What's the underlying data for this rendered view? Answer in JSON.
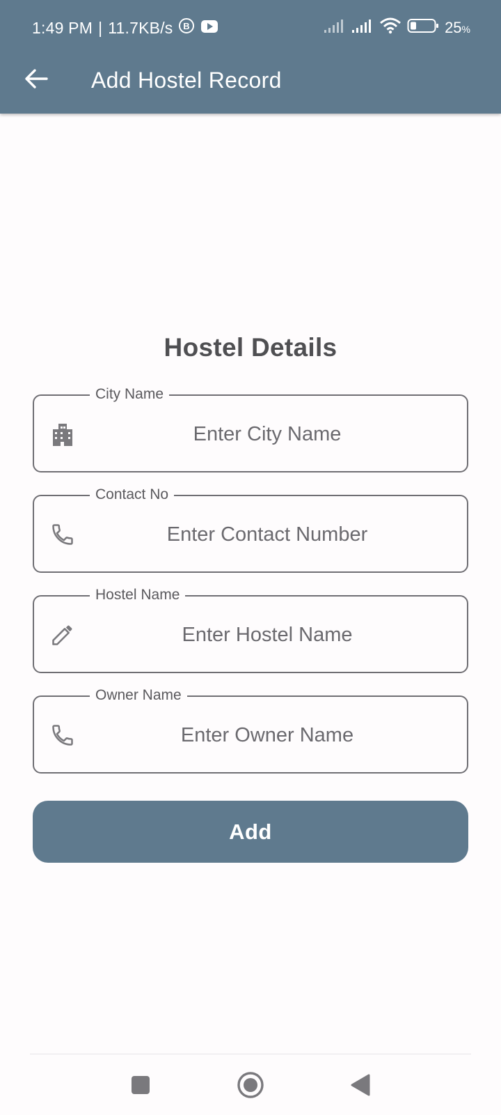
{
  "status_bar": {
    "time": "1:49 PM",
    "separator": "|",
    "speed": "11.7KB/s",
    "battery_percent": "25",
    "battery_unit": "%",
    "icons": [
      "b-circle-icon",
      "youtube-icon",
      "signal-weak-icon",
      "signal-icon",
      "wifi-icon",
      "battery-icon"
    ]
  },
  "app_bar": {
    "title": "Add Hostel Record",
    "back_icon": "arrow-left-icon"
  },
  "form": {
    "title": "Hostel Details",
    "fields": [
      {
        "label": "City Name",
        "placeholder": "Enter City Name",
        "value": "",
        "icon": "building-icon"
      },
      {
        "label": "Contact No",
        "placeholder": "Enter Contact Number",
        "value": "",
        "icon": "phone-icon"
      },
      {
        "label": "Hostel Name",
        "placeholder": "Enter Hostel Name",
        "value": "",
        "icon": "pencil-icon"
      },
      {
        "label": "Owner Name",
        "placeholder": "Enter Owner Name",
        "value": "",
        "icon": "phone-icon"
      }
    ],
    "submit_label": "Add"
  },
  "nav_bar": {
    "buttons": [
      "recents-square-icon",
      "home-circle-icon",
      "back-triangle-icon"
    ]
  },
  "colors": {
    "primary": "#5f7a8e",
    "background": "#fefcfd",
    "text": "#4f4f52",
    "field_border": "#6f6e73"
  }
}
